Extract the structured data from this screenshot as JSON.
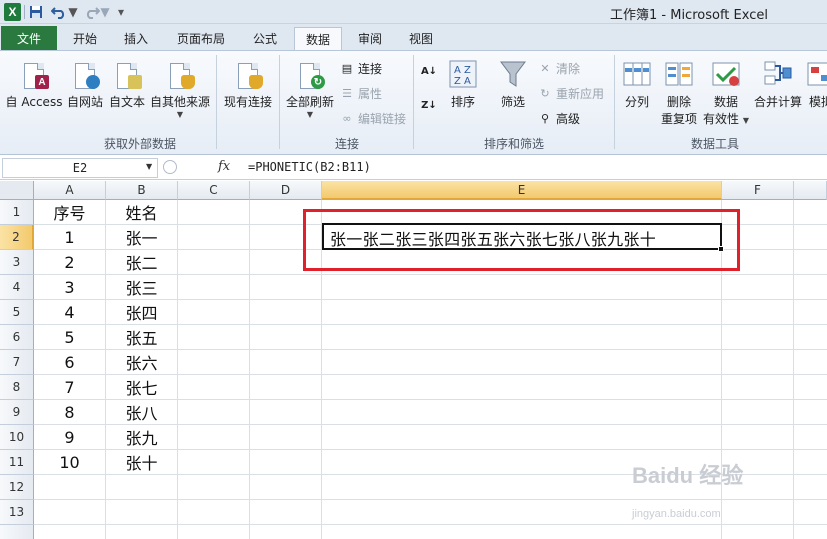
{
  "window": {
    "title": "工作簿1 - Microsoft Excel"
  },
  "quick_access": {
    "logo": "X"
  },
  "tabs": [
    {
      "label": "文件"
    },
    {
      "label": "开始"
    },
    {
      "label": "插入"
    },
    {
      "label": "页面布局"
    },
    {
      "label": "公式"
    },
    {
      "label": "数据"
    },
    {
      "label": "审阅"
    },
    {
      "label": "视图"
    }
  ],
  "ribbon": {
    "get_external": {
      "group_label": "获取外部数据",
      "from_access": "自 Access",
      "from_web": "自网站",
      "from_text": "自文本",
      "from_other": "自其他来源",
      "existing": "现有连接"
    },
    "connections": {
      "group_label": "连接",
      "refresh_all": "全部刷新",
      "connections": "连接",
      "properties": "属性",
      "edit_links": "编辑链接"
    },
    "sort_filter": {
      "group_label": "排序和筛选",
      "sort": "排序",
      "filter": "筛选",
      "clear": "清除",
      "reapply": "重新应用",
      "advanced": "高级"
    },
    "data_tools": {
      "group_label": "数据工具",
      "text_to_columns": "分列",
      "remove_dup_1": "删除",
      "remove_dup_2": "重复项",
      "validation_1": "数据",
      "validation_2": "有效性",
      "consolidate": "合并计算",
      "whatif": "模拟"
    }
  },
  "formula_bar": {
    "name_box": "E2",
    "fx": "fx",
    "formula": "=PHONETIC(B2:B11)"
  },
  "grid": {
    "columns": [
      "A",
      "B",
      "C",
      "D",
      "E",
      "F"
    ],
    "rows": [
      "1",
      "2",
      "3",
      "4",
      "5",
      "6",
      "7",
      "8",
      "9",
      "10",
      "11",
      "12",
      "13"
    ],
    "col_a": [
      "序号",
      "1",
      "2",
      "3",
      "4",
      "5",
      "6",
      "7",
      "8",
      "9",
      "10"
    ],
    "col_b": [
      "姓名",
      "张一",
      "张二",
      "张三",
      "张四",
      "张五",
      "张六",
      "张七",
      "张八",
      "张九",
      "张十"
    ],
    "e2": "张一张二张三张四张五张六张七张八张九张十"
  },
  "watermark": {
    "brand": "Baidu 经验",
    "url": "jingyan.baidu.com"
  },
  "colors": {
    "file_tab": "#2a7a3f",
    "selection_header": "#f3c96c",
    "highlight_box": "#e0202a"
  }
}
